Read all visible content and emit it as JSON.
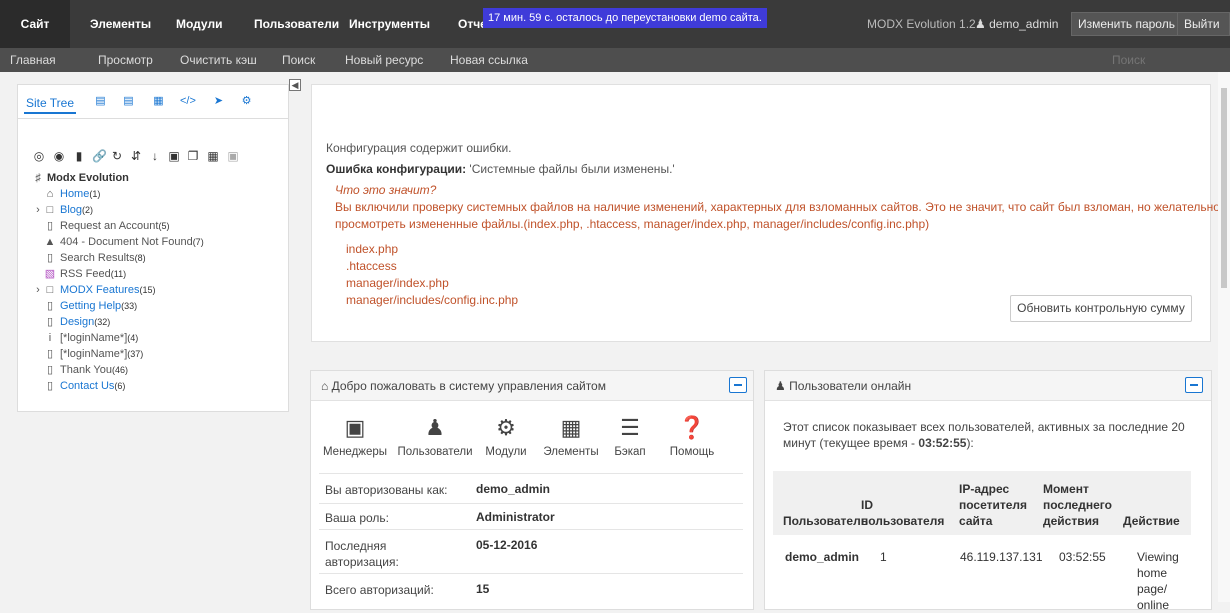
{
  "mainmenu": {
    "items": [
      "Сайт",
      "Элементы",
      "Модули",
      "Пользователи",
      "Инструменты",
      "Отчеты"
    ],
    "countdown": "17 мин. 59 с. осталось до переустановки demo сайта.",
    "version": "MODX Evolution 1.2",
    "user": "demo_admin",
    "change_password": "Изменить пароль",
    "logout": "Выйти"
  },
  "subbar": {
    "items": [
      "Главная",
      "Просмотр",
      "Очистить кэш",
      "Поиск",
      "Новый ресурс",
      "Новая ссылка"
    ],
    "search_placeholder": "Поиск"
  },
  "tree": {
    "tab_label": "Site Tree",
    "root": "Modx Evolution",
    "nodes": [
      {
        "label": "Home",
        "count": "(1)",
        "icon": "home-icon",
        "link": true
      },
      {
        "label": "Blog",
        "count": "(2)",
        "icon": "folder-icon",
        "link": true,
        "expand": true
      },
      {
        "label": "Request an Account",
        "count": "(5)",
        "icon": "page-icon",
        "link": false
      },
      {
        "label": "404 - Document Not Found",
        "count": "(7)",
        "icon": "warning-icon",
        "link": false
      },
      {
        "label": "Search Results",
        "count": "(8)",
        "icon": "page-icon",
        "link": false
      },
      {
        "label": "RSS Feed",
        "count": "(11)",
        "icon": "rss-icon",
        "link": false
      },
      {
        "label": "MODX Features",
        "count": "(15)",
        "icon": "folder-icon",
        "link": true,
        "expand": true
      },
      {
        "label": "Getting Help",
        "count": "(33)",
        "icon": "page-icon",
        "link": true
      },
      {
        "label": "Design",
        "count": "(32)",
        "icon": "page-icon",
        "link": true
      },
      {
        "label": "[*loginName*]",
        "count": "(4)",
        "icon": "info-icon",
        "link": false
      },
      {
        "label": "[*loginName*]",
        "count": "(37)",
        "icon": "page-icon",
        "link": false
      },
      {
        "label": "Thank You",
        "count": "(46)",
        "icon": "page-icon",
        "link": false
      },
      {
        "label": "Contact Us",
        "count": "(6)",
        "icon": "page-icon",
        "link": true
      }
    ]
  },
  "config": {
    "line1": "Конфигурация содержит ошибки.",
    "error_label": "Ошибка конфигурации:",
    "error_text": " 'Системные файлы были изменены.'",
    "what_means": "Что это значит?",
    "desc1": "Вы включили проверку системных файлов на наличие изменений, характерных для взломанных сайтов. Это не значит, что сайт был взломан, но желательно",
    "desc2": "просмотреть измененные файлы.(index.php, .htaccess, manager/index.php, manager/includes/config.inc.php)",
    "files": [
      "index.php",
      ".htaccess",
      "manager/index.php",
      "manager/includes/config.inc.php"
    ],
    "update_button": "Обновить контрольную сумму"
  },
  "welcome": {
    "title": "Добро пожаловать в систему управления сайтом",
    "icons": [
      "Менеджеры",
      "Пользователи",
      "Модули",
      "Элементы",
      "Бэкап",
      "Помощь"
    ],
    "rows": [
      {
        "k": "Вы авторизованы как:",
        "v": "demo_admin"
      },
      {
        "k": "Ваша роль:",
        "v": "Administrator"
      },
      {
        "k": "Последняя авторизация:",
        "v": "05-12-2016"
      },
      {
        "k": "Всего авторизаций:",
        "v": "15"
      }
    ]
  },
  "online": {
    "title": "Пользователи онлайн",
    "desc1": "Этот список показывает всех пользователей, активных за последние 20",
    "desc2_a": "минут (текущее время - ",
    "desc2_b": "03:52:55",
    "desc2_c": "):",
    "headers": [
      "Пользователь",
      "ID пользователя",
      "IP-адрес посетителя сайта",
      "Момент последнего действия",
      "Действие"
    ],
    "row": {
      "user": "demo_admin",
      "id": "1",
      "ip": "46.119.137.131",
      "time": "03:52:55",
      "action": "Viewing home page/ online"
    }
  }
}
